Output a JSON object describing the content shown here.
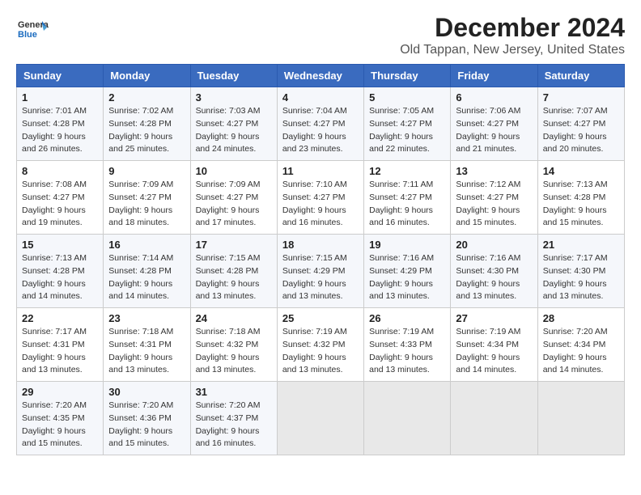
{
  "logo": {
    "text_general": "General",
    "text_blue": "Blue"
  },
  "title": "December 2024",
  "subtitle": "Old Tappan, New Jersey, United States",
  "days_of_week": [
    "Sunday",
    "Monday",
    "Tuesday",
    "Wednesday",
    "Thursday",
    "Friday",
    "Saturday"
  ],
  "weeks": [
    [
      {
        "day": 1,
        "sunrise": "7:01 AM",
        "sunset": "4:28 PM",
        "daylight": "9 hours and 26 minutes."
      },
      {
        "day": 2,
        "sunrise": "7:02 AM",
        "sunset": "4:28 PM",
        "daylight": "9 hours and 25 minutes."
      },
      {
        "day": 3,
        "sunrise": "7:03 AM",
        "sunset": "4:27 PM",
        "daylight": "9 hours and 24 minutes."
      },
      {
        "day": 4,
        "sunrise": "7:04 AM",
        "sunset": "4:27 PM",
        "daylight": "9 hours and 23 minutes."
      },
      {
        "day": 5,
        "sunrise": "7:05 AM",
        "sunset": "4:27 PM",
        "daylight": "9 hours and 22 minutes."
      },
      {
        "day": 6,
        "sunrise": "7:06 AM",
        "sunset": "4:27 PM",
        "daylight": "9 hours and 21 minutes."
      },
      {
        "day": 7,
        "sunrise": "7:07 AM",
        "sunset": "4:27 PM",
        "daylight": "9 hours and 20 minutes."
      }
    ],
    [
      {
        "day": 8,
        "sunrise": "7:08 AM",
        "sunset": "4:27 PM",
        "daylight": "9 hours and 19 minutes."
      },
      {
        "day": 9,
        "sunrise": "7:09 AM",
        "sunset": "4:27 PM",
        "daylight": "9 hours and 18 minutes."
      },
      {
        "day": 10,
        "sunrise": "7:09 AM",
        "sunset": "4:27 PM",
        "daylight": "9 hours and 17 minutes."
      },
      {
        "day": 11,
        "sunrise": "7:10 AM",
        "sunset": "4:27 PM",
        "daylight": "9 hours and 16 minutes."
      },
      {
        "day": 12,
        "sunrise": "7:11 AM",
        "sunset": "4:27 PM",
        "daylight": "9 hours and 16 minutes."
      },
      {
        "day": 13,
        "sunrise": "7:12 AM",
        "sunset": "4:27 PM",
        "daylight": "9 hours and 15 minutes."
      },
      {
        "day": 14,
        "sunrise": "7:13 AM",
        "sunset": "4:28 PM",
        "daylight": "9 hours and 15 minutes."
      }
    ],
    [
      {
        "day": 15,
        "sunrise": "7:13 AM",
        "sunset": "4:28 PM",
        "daylight": "9 hours and 14 minutes."
      },
      {
        "day": 16,
        "sunrise": "7:14 AM",
        "sunset": "4:28 PM",
        "daylight": "9 hours and 14 minutes."
      },
      {
        "day": 17,
        "sunrise": "7:15 AM",
        "sunset": "4:28 PM",
        "daylight": "9 hours and 13 minutes."
      },
      {
        "day": 18,
        "sunrise": "7:15 AM",
        "sunset": "4:29 PM",
        "daylight": "9 hours and 13 minutes."
      },
      {
        "day": 19,
        "sunrise": "7:16 AM",
        "sunset": "4:29 PM",
        "daylight": "9 hours and 13 minutes."
      },
      {
        "day": 20,
        "sunrise": "7:16 AM",
        "sunset": "4:30 PM",
        "daylight": "9 hours and 13 minutes."
      },
      {
        "day": 21,
        "sunrise": "7:17 AM",
        "sunset": "4:30 PM",
        "daylight": "9 hours and 13 minutes."
      }
    ],
    [
      {
        "day": 22,
        "sunrise": "7:17 AM",
        "sunset": "4:31 PM",
        "daylight": "9 hours and 13 minutes."
      },
      {
        "day": 23,
        "sunrise": "7:18 AM",
        "sunset": "4:31 PM",
        "daylight": "9 hours and 13 minutes."
      },
      {
        "day": 24,
        "sunrise": "7:18 AM",
        "sunset": "4:32 PM",
        "daylight": "9 hours and 13 minutes."
      },
      {
        "day": 25,
        "sunrise": "7:19 AM",
        "sunset": "4:32 PM",
        "daylight": "9 hours and 13 minutes."
      },
      {
        "day": 26,
        "sunrise": "7:19 AM",
        "sunset": "4:33 PM",
        "daylight": "9 hours and 13 minutes."
      },
      {
        "day": 27,
        "sunrise": "7:19 AM",
        "sunset": "4:34 PM",
        "daylight": "9 hours and 14 minutes."
      },
      {
        "day": 28,
        "sunrise": "7:20 AM",
        "sunset": "4:34 PM",
        "daylight": "9 hours and 14 minutes."
      }
    ],
    [
      {
        "day": 29,
        "sunrise": "7:20 AM",
        "sunset": "4:35 PM",
        "daylight": "9 hours and 15 minutes."
      },
      {
        "day": 30,
        "sunrise": "7:20 AM",
        "sunset": "4:36 PM",
        "daylight": "9 hours and 15 minutes."
      },
      {
        "day": 31,
        "sunrise": "7:20 AM",
        "sunset": "4:37 PM",
        "daylight": "9 hours and 16 minutes."
      },
      null,
      null,
      null,
      null
    ]
  ]
}
